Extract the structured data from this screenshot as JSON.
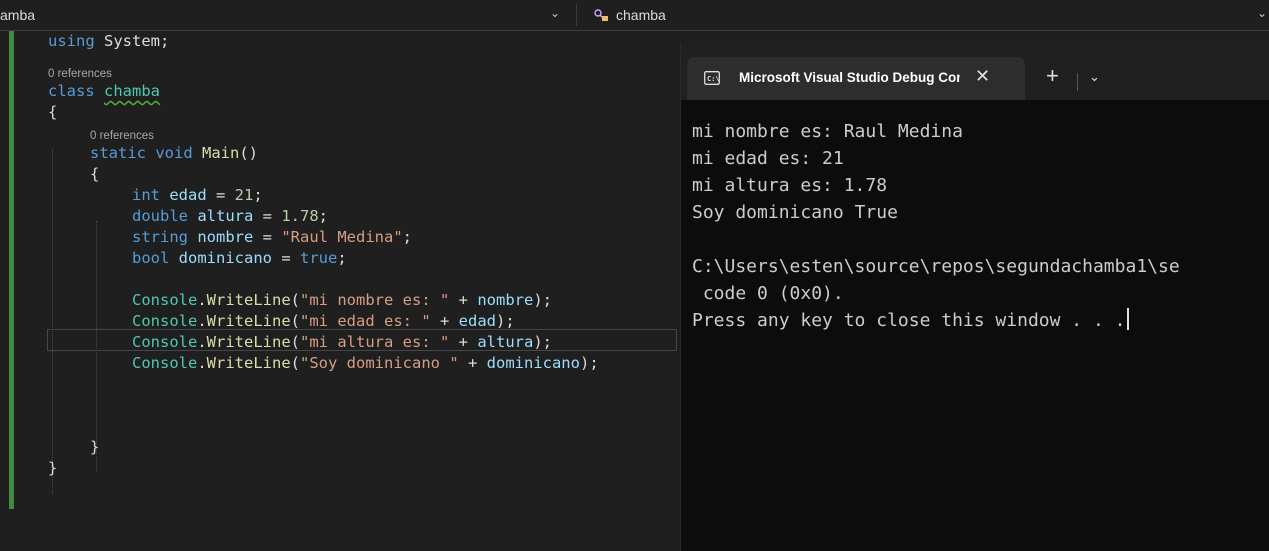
{
  "navbar": {
    "left_dropdown": "amba",
    "right_dropdown": "chamba",
    "right_icon": "class-icon"
  },
  "editor": {
    "lines": {
      "using": "using",
      "system": "System;",
      "ref1": "0 references",
      "class_kw": "class",
      "class_name": "chamba",
      "open1": "{",
      "ref2": "0 references",
      "static_kw": "static",
      "void_kw": "void",
      "main": "Main",
      "main_parens": "()",
      "open2": "{",
      "int_kw": "int",
      "edad": "edad",
      "eq": " = ",
      "edad_val": "21",
      "semi": ";",
      "double_kw": "double",
      "altura": "altura",
      "altura_val": "1.78",
      "string_kw": "string",
      "nombre": "nombre",
      "nombre_val": "\"Raul Medina\"",
      "bool_kw": "bool",
      "dominicano": "dominicano",
      "dominicano_val": "true",
      "console": "Console",
      "dot": ".",
      "writeline": "WriteLine",
      "wl1_str": "\"mi nombre es: \"",
      "wl2_str": "\"mi edad es: \"",
      "wl3_str": "\"mi altura es: \"",
      "wl4_str": "\"Soy dominicano \"",
      "close2": "}",
      "close1": "}"
    }
  },
  "terminal": {
    "tab_title": "Microsoft Visual Studio Debug Console",
    "close_symbol": "✕",
    "new_tab_symbol": "+",
    "dropdown_symbol": "⌄",
    "output": [
      "mi nombre es: Raul Medina",
      "mi edad es: 21",
      "mi altura es: 1.78",
      "Soy dominicano True",
      "",
      "C:\\Users\\esten\\source\\repos\\segundachamba1\\se",
      " code 0 (0x0).",
      "Press any key to close this window . . ."
    ]
  },
  "colors": {
    "keyword": "#569cd6",
    "class": "#4ec9b0",
    "method": "#dcdcaa",
    "variable": "#9cdcfe",
    "string": "#d69d85",
    "number": "#b5cea8",
    "change_bar": "#3e8a3e"
  }
}
